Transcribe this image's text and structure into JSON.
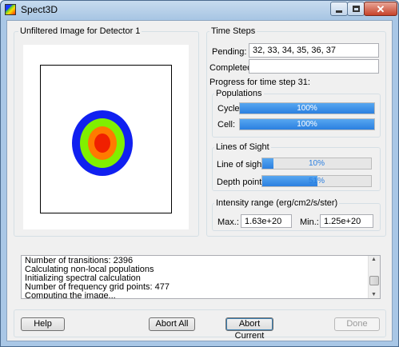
{
  "window": {
    "title": "Spect3D",
    "app_icon": "spect3d-app-icon"
  },
  "image_group": {
    "title": "Unfiltered Image for Detector 1"
  },
  "time_steps": {
    "title": "Time Steps",
    "pending_label": "Pending:",
    "pending_value": "32, 33, 34, 35, 36, 37",
    "completed_label": "Completed:",
    "completed_value": "",
    "progress_label": "Progress for time step 31:"
  },
  "populations": {
    "title": "Populations",
    "cycle_label": "Cycle:",
    "cycle_percent": 100,
    "cycle_text": "100%",
    "cell_label": "Cell:",
    "cell_percent": 100,
    "cell_text": "100%"
  },
  "lines_of_sight": {
    "title": "Lines of Sight",
    "los_label": "Line of sight:",
    "los_percent": 10,
    "los_text": "10%",
    "depth_label": "Depth point:",
    "depth_percent": 51,
    "depth_text": "51%"
  },
  "intensity": {
    "title": "Intensity range (erg/cm2/s/ster)",
    "max_label": "Max.:",
    "max_value": "1.63e+20",
    "min_label": "Min.:",
    "min_value": "1.25e+20"
  },
  "log": {
    "lines": [
      "Number of transitions: 2396",
      "Calculating non-local populations",
      "Initializing spectral calculation",
      "Number of frequency grid points: 477",
      "Computing the image..."
    ]
  },
  "buttons": {
    "help": "Help",
    "abort_all": "Abort All",
    "abort_current": "Abort Current",
    "done": "Done"
  },
  "colors": {
    "ring_blue": "#1020f0",
    "ring_green": "#80f000",
    "ring_orange": "#ff7a00",
    "core_red": "#f02000",
    "progress_fill": "#2b7fe0"
  }
}
